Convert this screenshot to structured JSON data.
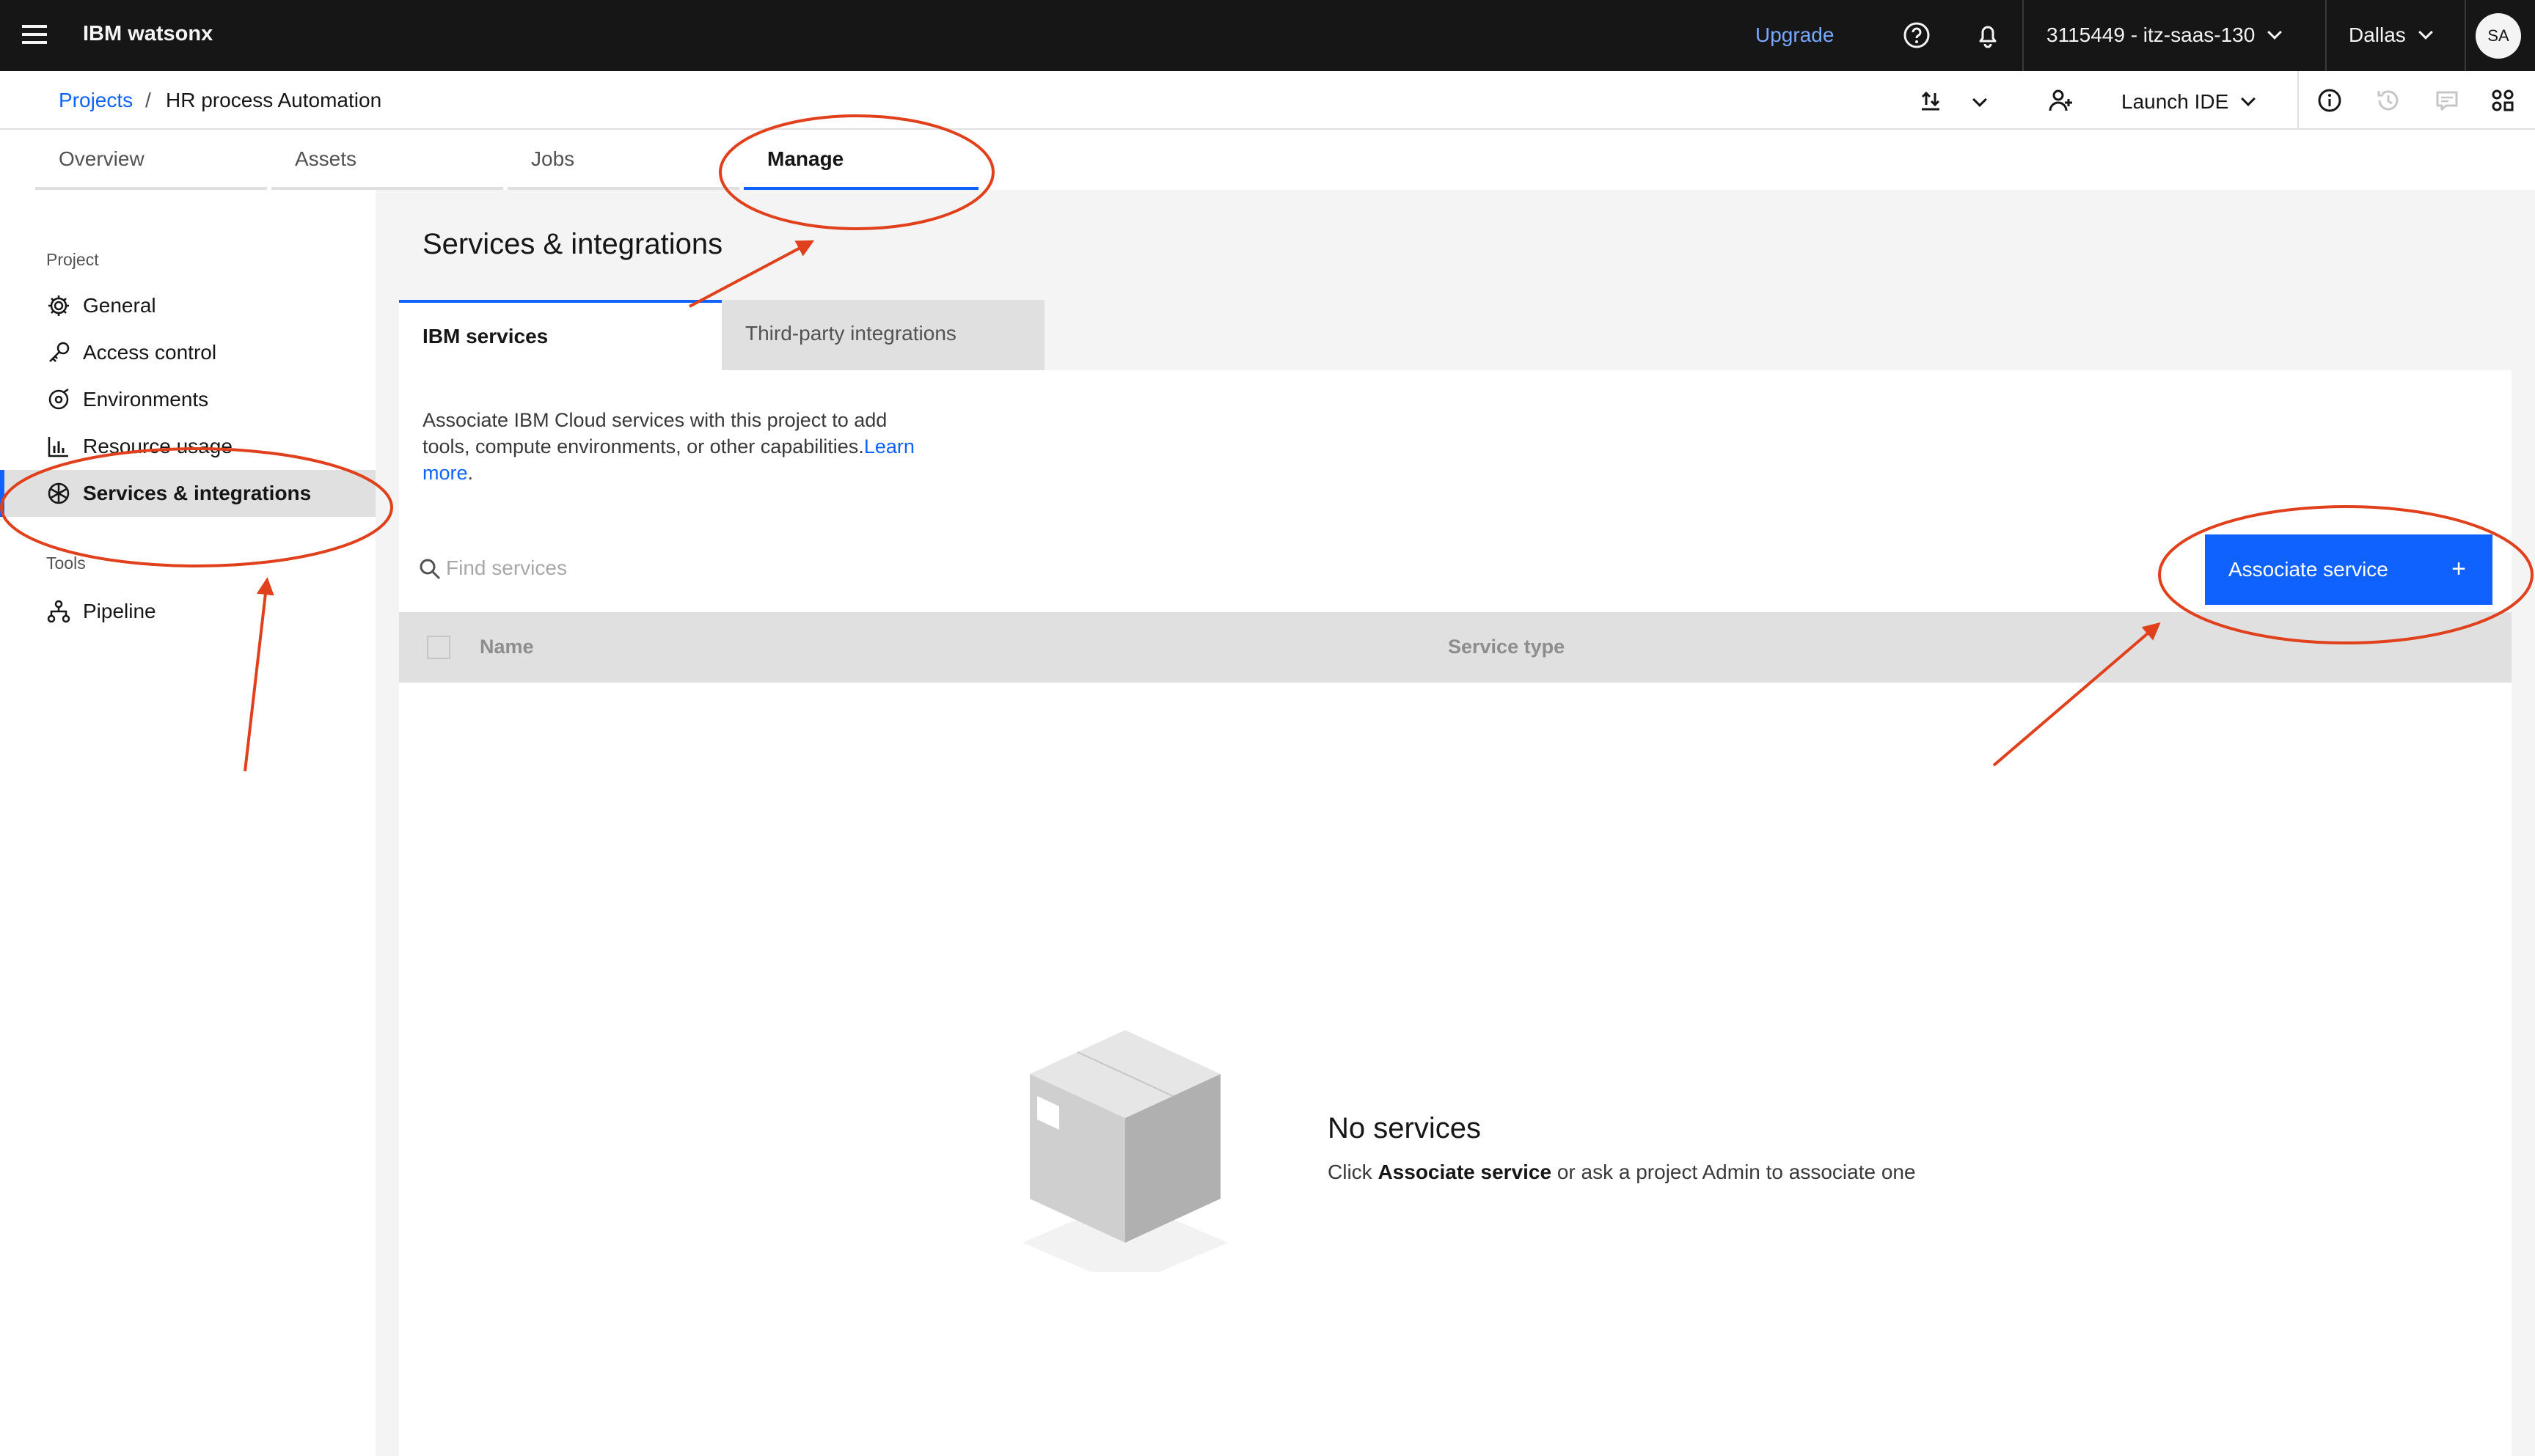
{
  "header": {
    "brand": "IBM watsonx",
    "upgrade": "Upgrade",
    "account": "3115449 - itz-saas-130",
    "region": "Dallas",
    "avatar": "SA"
  },
  "breadcrumb": {
    "parent": "Projects",
    "separator": "/",
    "current": "HR process Automation"
  },
  "toolbar": {
    "launch_ide": "Launch IDE"
  },
  "tabs": [
    {
      "label": "Overview"
    },
    {
      "label": "Assets"
    },
    {
      "label": "Jobs"
    },
    {
      "label": "Manage"
    }
  ],
  "sidebar": {
    "project_section": "Project",
    "items": [
      {
        "label": "General",
        "icon": "gear-icon"
      },
      {
        "label": "Access control",
        "icon": "key-icon"
      },
      {
        "label": "Environments",
        "icon": "environment-icon"
      },
      {
        "label": "Resource usage",
        "icon": "chart-bar-icon"
      },
      {
        "label": "Services & integrations",
        "icon": "services-icon"
      }
    ],
    "tools_section": "Tools",
    "tools_items": [
      {
        "label": "Pipeline",
        "icon": "pipeline-icon"
      }
    ]
  },
  "main": {
    "title": "Services & integrations",
    "subtabs": [
      {
        "label": "IBM services"
      },
      {
        "label": "Third-party integrations"
      }
    ],
    "description": "Associate IBM Cloud services with this project to add tools, compute environments, or other capabilities.",
    "learn_more": "Learn more",
    "period": ".",
    "search_placeholder": "Find services",
    "associate_button": "Associate service",
    "associate_plus": "+",
    "columns": [
      "Name",
      "Service type"
    ],
    "empty_title": "No services",
    "empty_text_prefix": "Click ",
    "empty_text_bold": "Associate service",
    "empty_text_suffix": " or ask a project Admin to associate one"
  },
  "colors": {
    "accent": "#0f62fe",
    "header_bg": "#161616",
    "annotation": "#e0401c"
  }
}
